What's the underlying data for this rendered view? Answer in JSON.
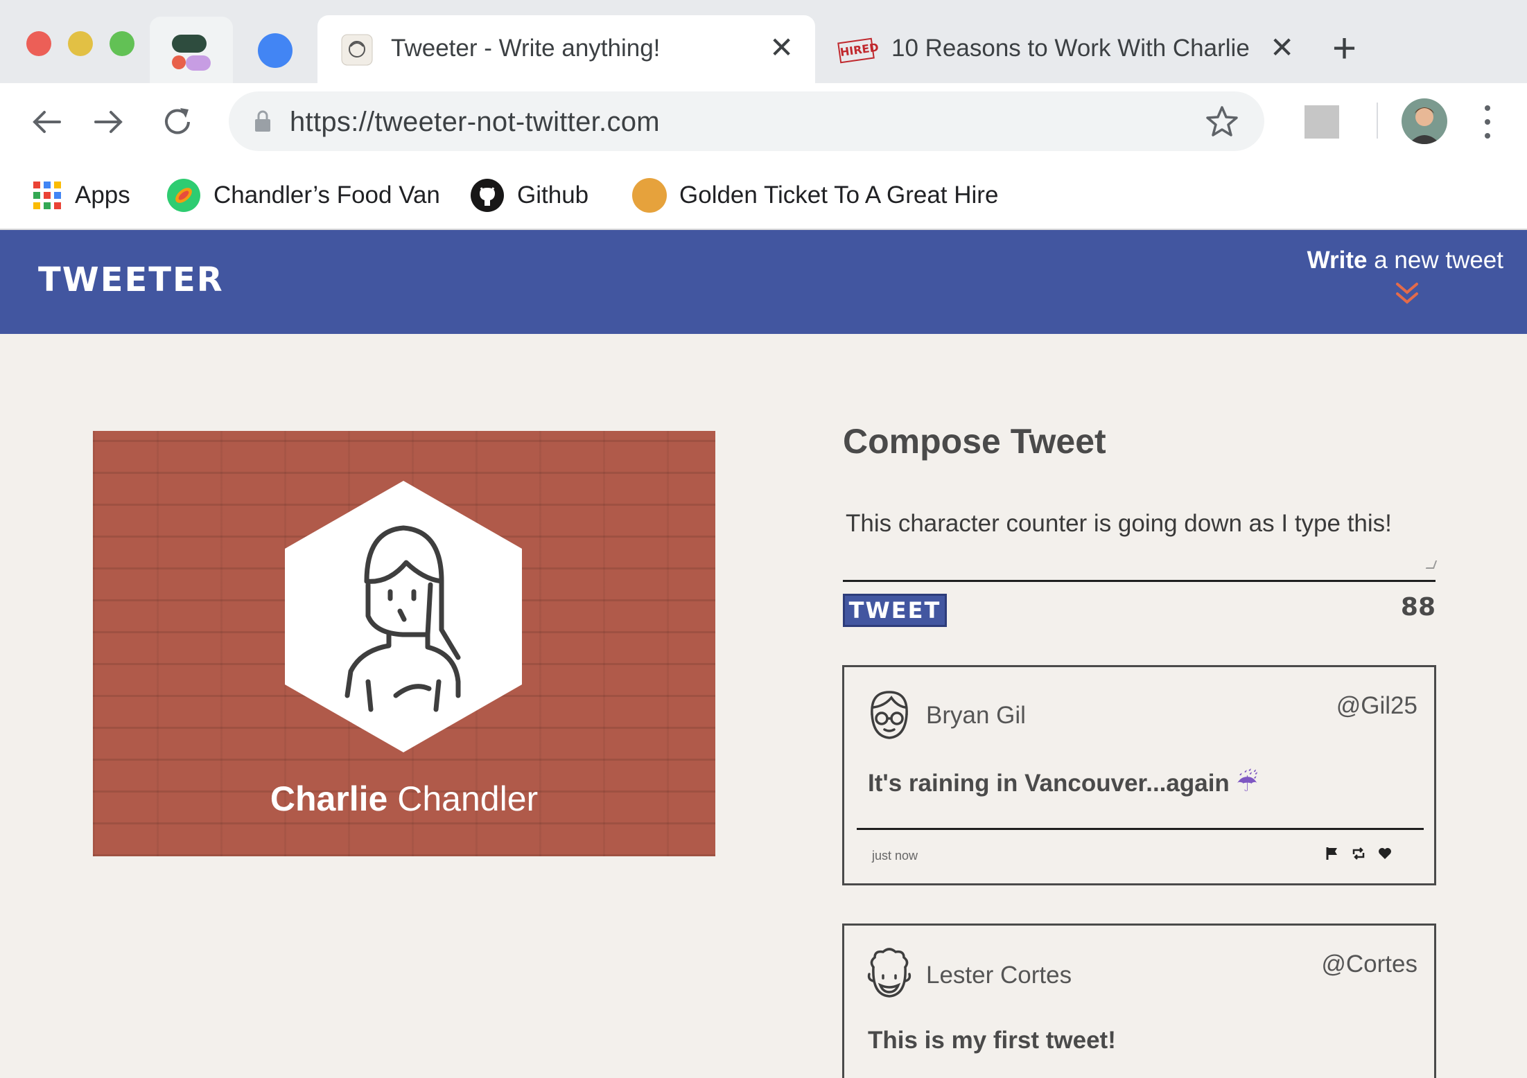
{
  "browser": {
    "traffic_lights": [
      "#ec5f57",
      "#e2c044",
      "#62c155"
    ],
    "tabs": [
      {
        "title": "Tweeter - Write anything!",
        "active": true
      },
      {
        "title": "10 Reasons to Work With Charlie",
        "active": false
      }
    ],
    "url": "https://tweeter-not-twitter.com",
    "bookmarks": [
      {
        "label": "Apps",
        "icon": "apps-grid-icon"
      },
      {
        "label": "Chandler’s Food Van",
        "icon": "food-van-icon"
      },
      {
        "label": "Github",
        "icon": "github-icon"
      },
      {
        "label": "Golden Ticket To A Great Hire",
        "icon": "golden-circle-icon"
      }
    ],
    "favicon_tab2_text": "HIRED"
  },
  "site": {
    "brand": "TWEETER",
    "nav": {
      "write_bold": "Write",
      "write_rest": " a new tweet"
    },
    "accent": "#4256a0",
    "chevron_color": "#e46b4a"
  },
  "profile": {
    "first_name": "Charlie",
    "last_name": " Chandler",
    "card_color": "#b05a4a"
  },
  "compose": {
    "title": "Compose Tweet",
    "text": "This character counter is going down as I type this!",
    "button_label": "TWEET",
    "counter": "88"
  },
  "tweets": [
    {
      "name": "Bryan Gil",
      "handle": "@Gil25",
      "body": "It's raining in Vancouver...again",
      "emoji": "☔",
      "time": "just now"
    },
    {
      "name": "Lester Cortes",
      "handle": "@Cortes",
      "body": "This is my first tweet!"
    }
  ]
}
